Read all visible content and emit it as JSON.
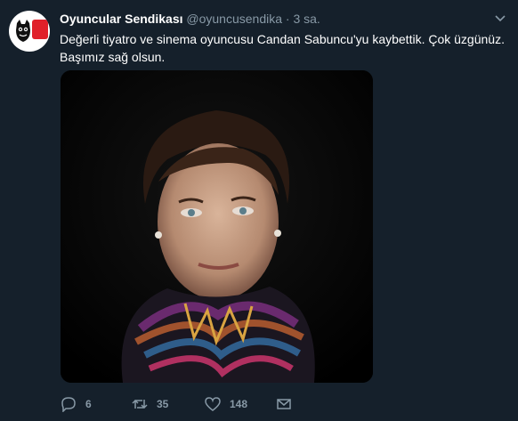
{
  "tweet": {
    "author_name": "Oyuncular Sendikası",
    "author_handle": "@oyuncusendika",
    "separator": "·",
    "time": "3 sa.",
    "text_line1": "Değerli tiyatro ve sinema oyuncusu Candan Sabuncu'yu kaybettik. Çok üzgünüz.",
    "text_line2": "Başımız sağ olsun.",
    "media_icon": "portrait-photo"
  },
  "actions": {
    "reply_count": "6",
    "retweet_count": "35",
    "like_count": "148"
  },
  "icons": {
    "reply": "reply-icon",
    "retweet": "retweet-icon",
    "like": "heart-icon",
    "dm": "mail-icon",
    "menu": "chevron-down-icon"
  },
  "colors": {
    "background": "#15202b",
    "secondary_text": "#8899a6",
    "brand_red": "#e0202a"
  }
}
